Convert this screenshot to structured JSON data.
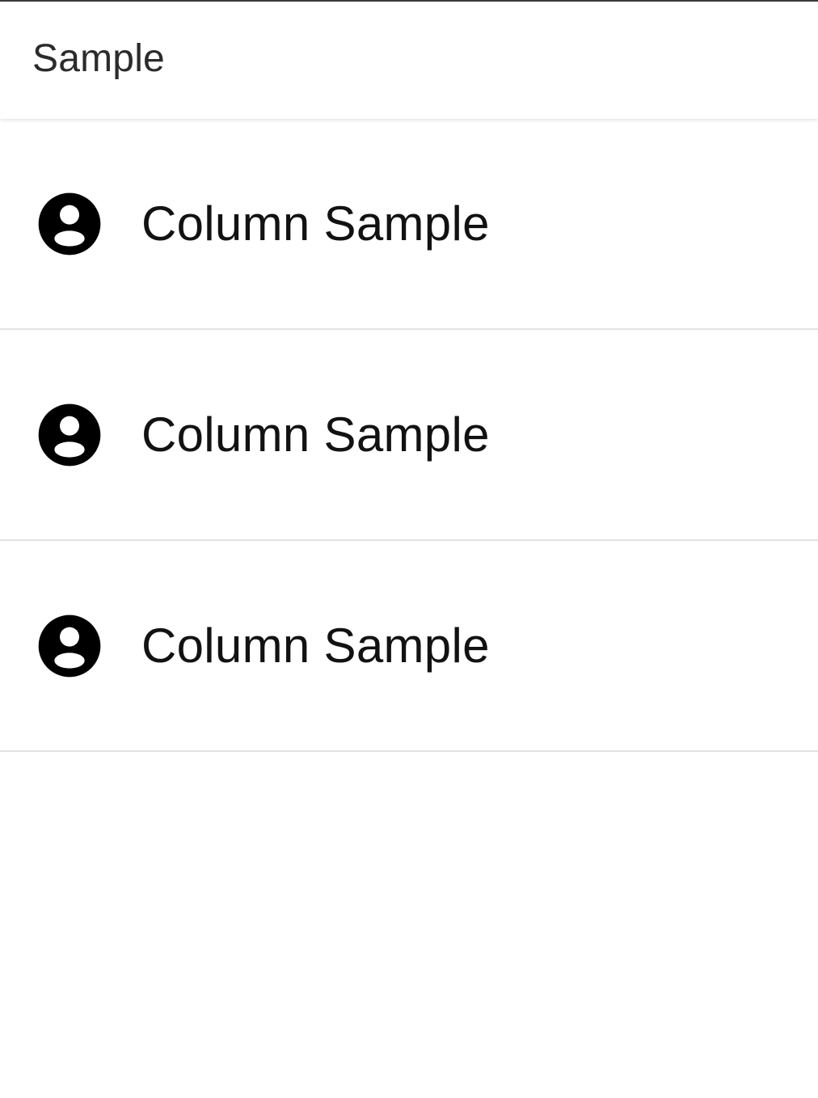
{
  "app_bar": {
    "title": "Sample"
  },
  "list": {
    "items": [
      {
        "icon": "account-circle-icon",
        "label": "Column Sample"
      },
      {
        "icon": "account-circle-icon",
        "label": "Column Sample"
      },
      {
        "icon": "account-circle-icon",
        "label": "Column Sample"
      }
    ]
  },
  "colors": {
    "background": "#ffffff",
    "title_text": "#2b2b2b",
    "item_text": "#121212",
    "divider": "#e2e2e2",
    "icon": "#000000"
  }
}
